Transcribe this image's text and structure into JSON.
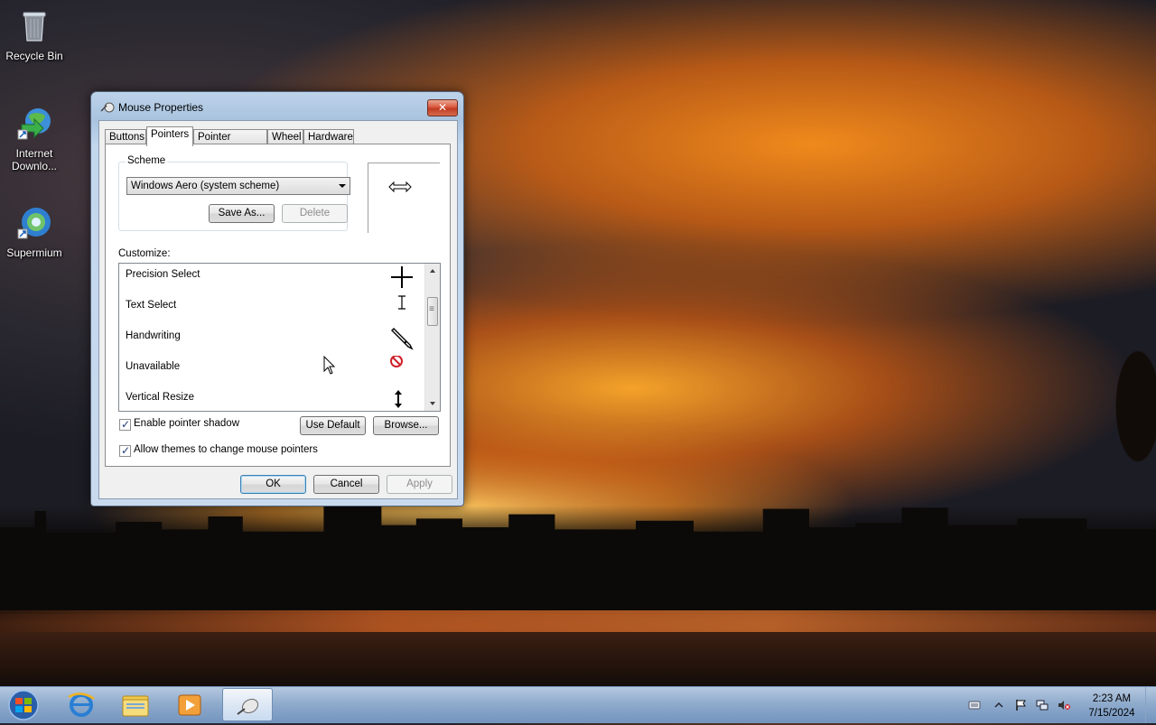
{
  "desktop": {
    "icons": [
      {
        "label": "Recycle Bin"
      },
      {
        "label": "Internet Downlo..."
      },
      {
        "label": "Supermium"
      }
    ]
  },
  "dialog": {
    "title": "Mouse Properties",
    "close_label": "✕",
    "tabs": [
      {
        "label": "Buttons"
      },
      {
        "label": "Pointers"
      },
      {
        "label": "Pointer Options"
      },
      {
        "label": "Wheel"
      },
      {
        "label": "Hardware"
      }
    ],
    "active_tab": "Pointers",
    "scheme": {
      "group_label": "Scheme",
      "selected": "Windows Aero (system scheme)",
      "save_as_label": "Save As...",
      "delete_label": "Delete"
    },
    "customize": {
      "label": "Customize:",
      "items": [
        {
          "name": "Precision Select",
          "icon": "crosshair-icon"
        },
        {
          "name": "Text Select",
          "icon": "text-beam-icon"
        },
        {
          "name": "Handwriting",
          "icon": "pen-icon"
        },
        {
          "name": "Unavailable",
          "icon": "unavailable-icon"
        },
        {
          "name": "Vertical Resize",
          "icon": "vertical-resize-icon"
        }
      ]
    },
    "enable_shadow_label": "Enable pointer shadow",
    "enable_shadow_checked": true,
    "use_default_label": "Use Default",
    "browse_label": "Browse...",
    "allow_themes_label": "Allow themes to change mouse pointers",
    "allow_themes_checked": true,
    "ok_label": "OK",
    "cancel_label": "Cancel",
    "apply_label": "Apply"
  },
  "taskbar": {
    "clock_time": "2:23 AM",
    "clock_date": "7/15/2024"
  },
  "colors": {
    "unavailable_red": "#d0202a",
    "accent_blue": "#3c7fb1"
  }
}
